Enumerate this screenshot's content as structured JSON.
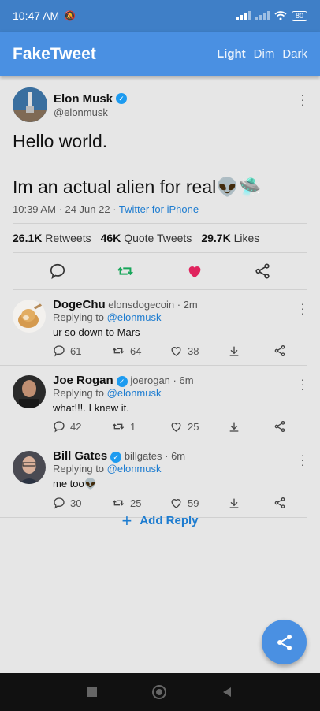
{
  "status_bar": {
    "time": "10:47 AM",
    "battery": "80"
  },
  "app_bar": {
    "title": "FakeTweet",
    "themes": [
      "Light",
      "Dim",
      "Dark"
    ],
    "selected_theme": "Light"
  },
  "tweet": {
    "name": "Elon Musk",
    "handle": "@elonmusk",
    "text": "Hello world.\n\nIm an actual alien for real👽🛸",
    "time": "10:39 AM · 24 Jun 22 · ",
    "client": "Twitter for iPhone",
    "stats": {
      "retweets": "26.1K",
      "retweets_label": "Retweets",
      "quotes": "46K",
      "quotes_label": "Quote Tweets",
      "likes": "29.7K",
      "likes_label": "Likes"
    }
  },
  "replies": [
    {
      "name": "DogeChu",
      "verified": false,
      "handle": "elonsdogecoin · 2m",
      "replying_prefix": "Replying to ",
      "replying_to": "@elonmusk",
      "text": "ur so down to Mars",
      "comments": "61",
      "retweets": "64",
      "likes": "38"
    },
    {
      "name": "Joe Rogan",
      "verified": true,
      "handle": "joerogan · 6m",
      "replying_prefix": "Replying to ",
      "replying_to": "@elonmusk",
      "text": "what!!!. I knew it.",
      "comments": "42",
      "retweets": "1",
      "likes": "25"
    },
    {
      "name": "Bill Gates",
      "verified": true,
      "handle": "billgates · 6m",
      "replying_prefix": "Replying to ",
      "replying_to": "@elonmusk",
      "text": "me too👽",
      "comments": "30",
      "retweets": "25",
      "likes": "59"
    }
  ],
  "add_reply": "Add Reply",
  "colors": {
    "primary": "#4a90e2",
    "status_bar": "#3f7fc7",
    "retweet": "#17a65a",
    "like": "#e0245e",
    "link": "#1d7cd0"
  }
}
